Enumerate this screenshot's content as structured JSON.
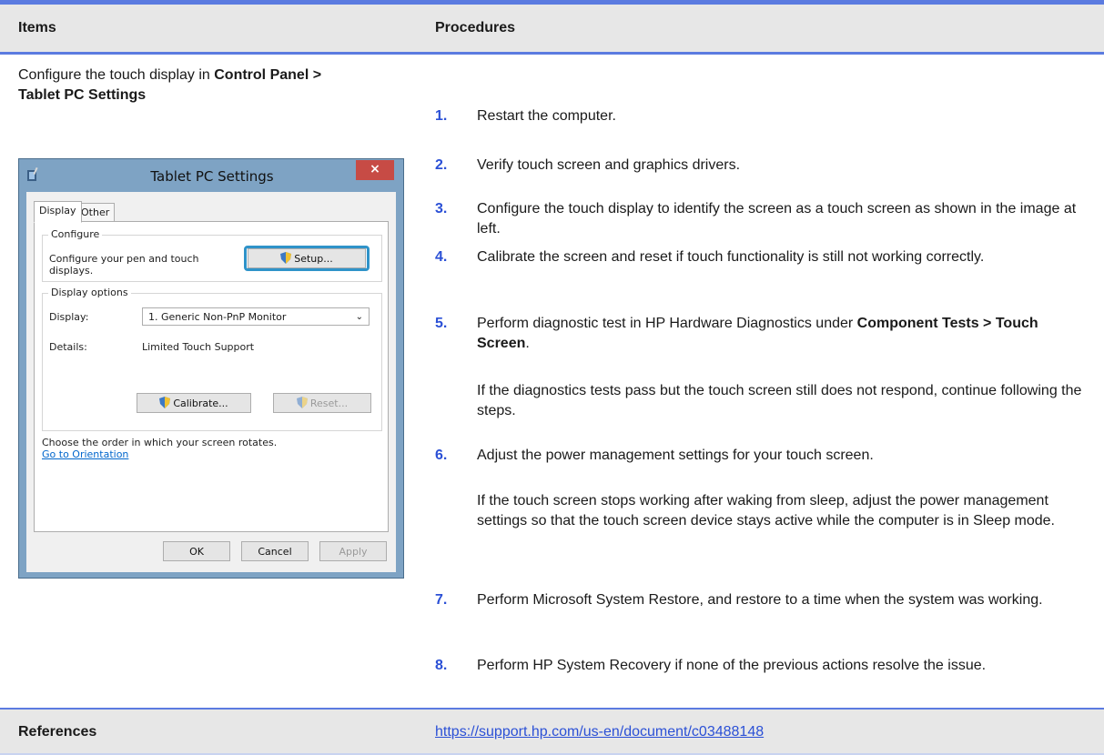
{
  "header": {
    "col1": "Items",
    "col2": "Procedures"
  },
  "item": {
    "line1": "Configure the touch display in ",
    "line1_bold": "Control Panel >",
    "line2_bold": "Tablet PC Settings"
  },
  "dialog": {
    "title": "Tablet PC Settings",
    "close": "×",
    "tabs": [
      "Display",
      "Other"
    ],
    "configure_group": "Configure",
    "configure_text_1": "Configure your pen and touch",
    "configure_text_2": "displays.",
    "setup_button": "Setup...",
    "display_options_group": "Display options",
    "display_label": "Display:",
    "display_value": "1. Generic Non-PnP Monitor",
    "details_label": "Details:",
    "details_value": "Limited Touch Support",
    "calibrate_button": "Calibrate...",
    "reset_button": "Reset...",
    "orientation_text": "Choose the order in which your screen rotates.",
    "orientation_link": "Go to Orientation",
    "ok_button": "OK",
    "cancel_button": "Cancel",
    "apply_button": "Apply"
  },
  "steps": [
    {
      "num": "1.",
      "text": "Restart the computer."
    },
    {
      "num": "2.",
      "text": "Verify touch screen and graphics drivers."
    },
    {
      "num": "3.",
      "text": "Configure the touch display to identify the screen as a touch screen as shown in the image at left."
    },
    {
      "num": "4.",
      "text": "Calibrate the screen and reset if touch functionality is still not working correctly."
    },
    {
      "num": "5.",
      "text": "Perform diagnostic test in HP Hardware Diagnostics under ",
      "bold": "Component Tests > Touch Screen",
      "tail": "."
    },
    {
      "num": "6.",
      "text": "Adjust the power management settings for your touch screen."
    },
    {
      "num": "7.",
      "text": "Perform Microsoft System Restore, and restore to a time when the system was working."
    },
    {
      "num": "8.",
      "text": "Perform HP System Recovery if none of the previous actions resolve the issue."
    }
  ],
  "notes": {
    "step5": "If the diagnostics tests pass but the touch screen still does not respond, continue following the steps.",
    "step6": "If the touch screen stops working after waking from sleep, adjust the power management settings so that the touch screen device stays active while the computer is in Sleep mode."
  },
  "references": {
    "label": "References",
    "link": "https://support.hp.com/us-en/document/c03488148"
  },
  "colors": {
    "accent": "#5b7be0",
    "number": "#2b50d6",
    "header_bg": "#e7e7e7"
  }
}
